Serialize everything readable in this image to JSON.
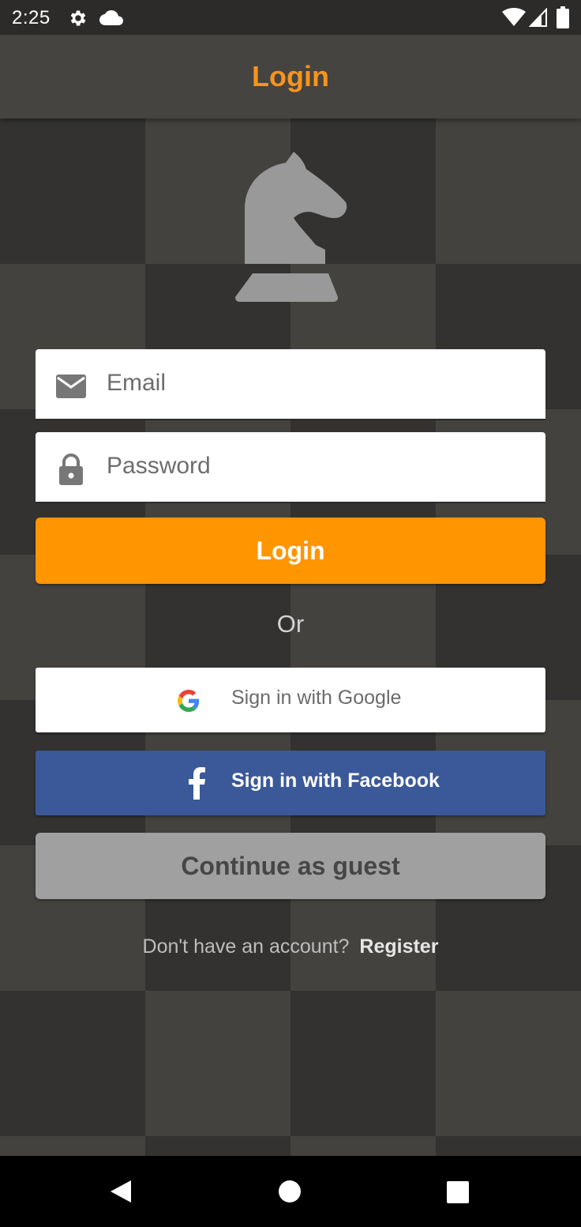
{
  "status_bar": {
    "time": "2:25",
    "icons": [
      "settings-gear-icon",
      "cloud-icon",
      "wifi-icon",
      "cell-signal-icon",
      "battery-icon"
    ]
  },
  "app_bar": {
    "title": "Login"
  },
  "logo": {
    "icon": "chess-knight-icon"
  },
  "email_field": {
    "placeholder": "Email",
    "value": "",
    "icon": "mail-icon"
  },
  "password_field": {
    "placeholder": "Password",
    "value": "",
    "icon": "lock-icon"
  },
  "login_button": {
    "label": "Login"
  },
  "divider_text": "Or",
  "google_button": {
    "label": "Sign in with Google",
    "icon": "google-icon"
  },
  "facebook_button": {
    "label": "Sign in with Facebook",
    "icon": "facebook-icon"
  },
  "guest_button": {
    "label": "Continue as guest"
  },
  "register": {
    "prompt": "Don't have an account?",
    "link": "Register"
  },
  "colors": {
    "accent": "#ff9500",
    "title": "#f7941d",
    "facebook": "#3b5998",
    "guest": "#a0a0a0",
    "board_dark": "#333231",
    "board_light": "#43423f"
  },
  "nav_bar": {
    "icons": [
      "back-icon",
      "home-icon",
      "recents-icon"
    ]
  }
}
